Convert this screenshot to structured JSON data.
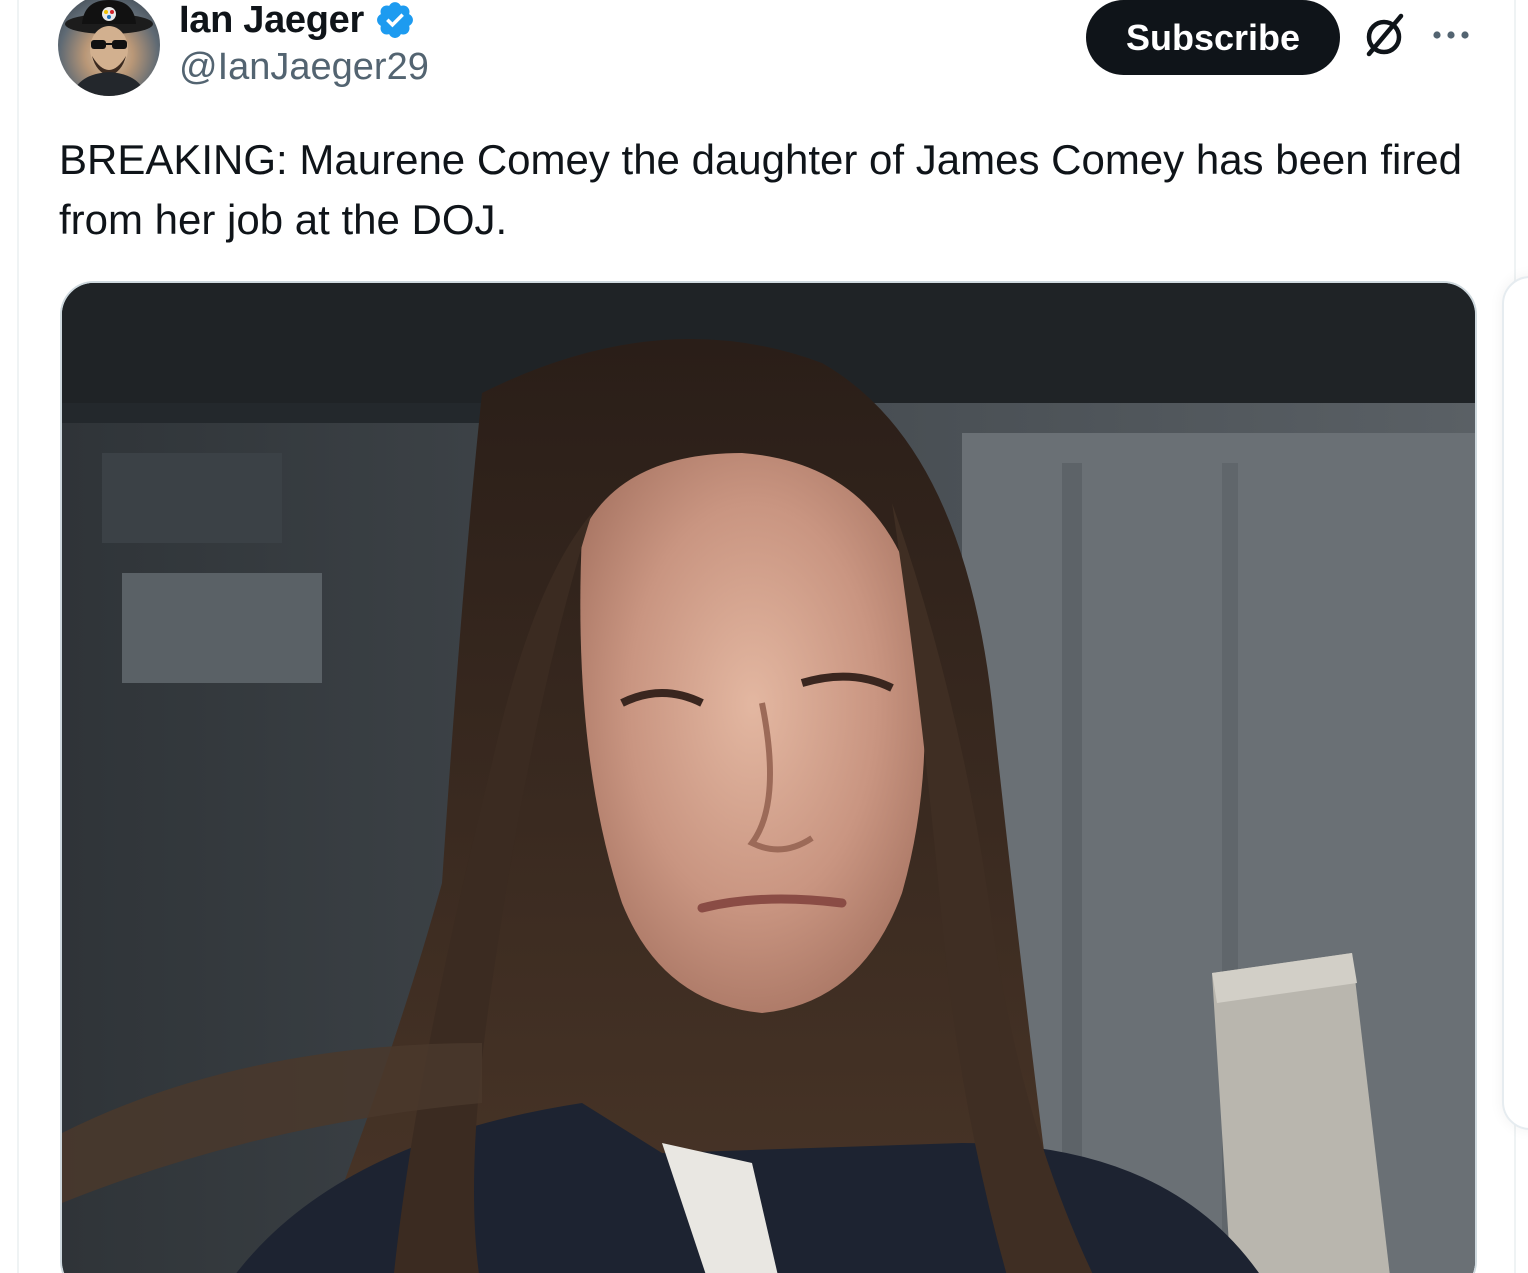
{
  "tweet": {
    "author": {
      "display_name": "Ian Jaeger",
      "handle": "@IanJaeger29",
      "verified": true
    },
    "subscribe_label": "Subscribe",
    "text": "BREAKING: Maurene Comey the daughter of James Comey has been fired from her job at the DOJ.",
    "media_type": "photo"
  },
  "icons": {
    "verified": "verified-badge-icon",
    "grok": "grok-icon",
    "more": "more-options-icon"
  },
  "colors": {
    "text_primary": "#0f1419",
    "text_secondary": "#536471",
    "verified_blue": "#1d9bf0",
    "button_bg": "#0f1419",
    "border": "#cfd9de"
  }
}
